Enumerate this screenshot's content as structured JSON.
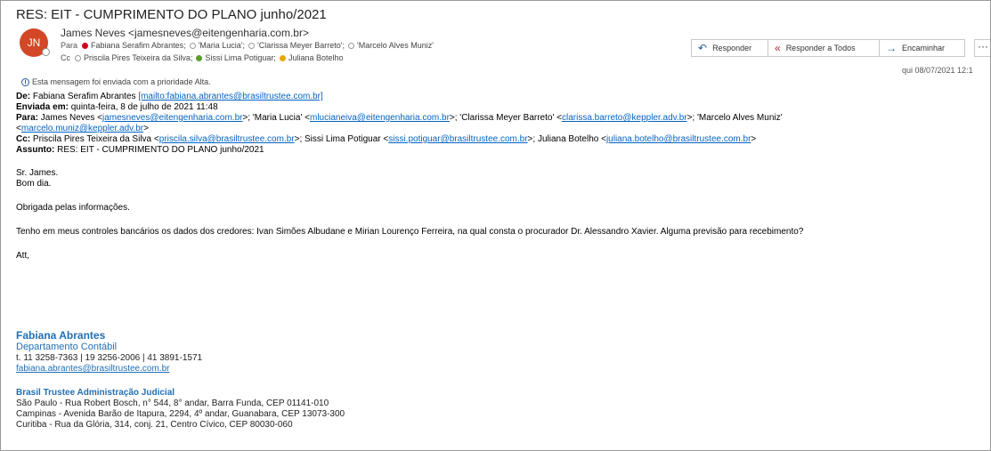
{
  "subject": "RES: EIT - CUMPRIMENTO DO PLANO junho/2021",
  "sender": {
    "initials": "JN",
    "display": "James Neves <jamesneves@eitengenharia.com.br>"
  },
  "header": {
    "para_label": "Para",
    "cc_label": "Cc",
    "to": [
      "Fabiana Serafim Abrantes;",
      "'Maria Lucia';",
      "'Clarissa Meyer Barreto';",
      "'Marcelo Alves Muniz'"
    ],
    "cc": [
      "Priscila Pires Teixeira da Silva;",
      "Sissi Lima Potiguar;",
      "Juliana Botelho"
    ],
    "priority": "Esta mensagem foi enviada com a prioridade Alta.",
    "date": "qui 08/07/2021 12:1"
  },
  "actions": {
    "reply": "Responder",
    "reply_all": "Responder a Todos",
    "forward": "Encaminhar",
    "more": "···"
  },
  "icons": {
    "reply": "reply-arrow-icon",
    "reply_all": "reply-all-arrow-icon",
    "forward": "forward-arrow-icon",
    "info": "info-icon",
    "more": "more-icon"
  },
  "colors": {
    "avatar": "#d24726",
    "link": "#0563c1",
    "signature": "#1f6fb5",
    "busy": "#d0021b",
    "available": "#5a9e2f",
    "away": "#e6a800"
  },
  "quoted": {
    "de_label": "De:",
    "de_name": "Fabiana Serafim Abrantes",
    "de_link": "[mailto:fabiana.abrantes@brasiltrustee.com.br]",
    "enviada_label": "Enviada em:",
    "enviada_value": "quinta-feira, 8 de julho de 2021 11:48",
    "para_label": "Para:",
    "para_t1": "James Neves <",
    "para_l1": "jamesneves@eitengenharia.com.br",
    "para_t2": ">; 'Maria Lucia' <",
    "para_l2": "mlucianeiva@eitengenharia.com.br",
    "para_t3": ">; 'Clarissa Meyer Barreto' <",
    "para_l3": "clarissa.barreto@keppler.adv.br",
    "para_t4": ">; 'Marcelo Alves Muniz'",
    "para_t5": "<",
    "para_l4": "marcelo.muniz@keppler.adv.br",
    "para_t6": ">",
    "cc_label": "Cc:",
    "cc_t1": "Priscila Pires Teixeira da Silva <",
    "cc_l1": "priscila.silva@brasiltrustee.com.br",
    "cc_t2": ">; Sissi Lima Potiguar <",
    "cc_l2": "sissi.potiguar@brasiltrustee.com.br",
    "cc_t3": ">; Juliana Botelho <",
    "cc_l3": "juliana.botelho@brasiltrustee.com.br",
    "cc_t4": ">",
    "assunto_label": "Assunto:",
    "assunto_value": "RES: EIT - CUMPRIMENTO DO PLANO junho/2021"
  },
  "message": {
    "greeting1": "Sr. James.",
    "greeting2": "Bom dia.",
    "p1": "Obrigada pelas informações.",
    "p2": "Tenho em meus controles bancários os dados dos credores: Ivan Simões Albudane e Mirian Lourenço Ferreira, na qual consta o procurador Dr. Alessandro Xavier. Alguma previsão para recebimento?",
    "closing": "Att,"
  },
  "signature": {
    "name": "Fabiana Abrantes",
    "dept": "Departamento Contábil",
    "phones": "t. 11 3258-7363 | 19 3256-2006 | 41 3891-1571",
    "email": "fabiana.abrantes@brasiltrustee.com.br",
    "company": "Brasil Trustee Administração Judicial",
    "addr1": "São Paulo - Rua Robert Bosch, n° 544, 8° andar, Barra Funda, CEP 01141-010",
    "addr2": "Campinas - Avenida Barão de Itapura, 2294, 4º andar, Guanabara, CEP 13073-300",
    "addr3": "Curitiba - Rua da Glória, 314, conj. 21, Centro Cívico, CEP 80030-060"
  }
}
